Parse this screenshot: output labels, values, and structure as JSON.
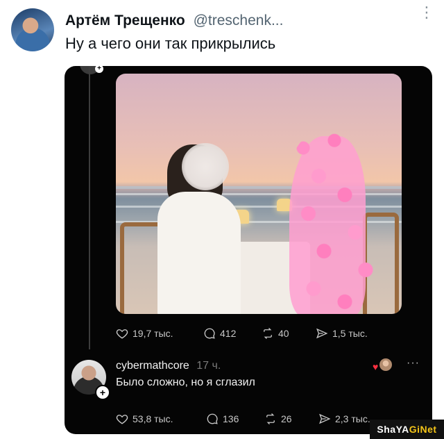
{
  "tweet": {
    "author_name": "Артём Трещенко",
    "author_handle": "@treschenk...",
    "text": "Ну а чего они так прикрылись",
    "more_label": "⋮"
  },
  "embedded_post": {
    "stats": {
      "likes": "19,7 тыс.",
      "comments": "412",
      "reposts": "40",
      "shares": "1,5 тыс."
    },
    "reply": {
      "username": "cybermathcore",
      "time": "17 ч.",
      "text": "Было сложно, но я сглазил",
      "more_label": "···",
      "stats": {
        "likes": "53,8 тыс.",
        "comments": "136",
        "reposts": "26",
        "shares": "2,3 тыс."
      }
    }
  },
  "watermark": {
    "text_left": "ShaYA",
    "text_right": "GiNet"
  },
  "colors": {
    "background": "#ffffff",
    "embedded_bg": "#050505",
    "handle": "#536471",
    "like_heart": "#ff3040"
  }
}
